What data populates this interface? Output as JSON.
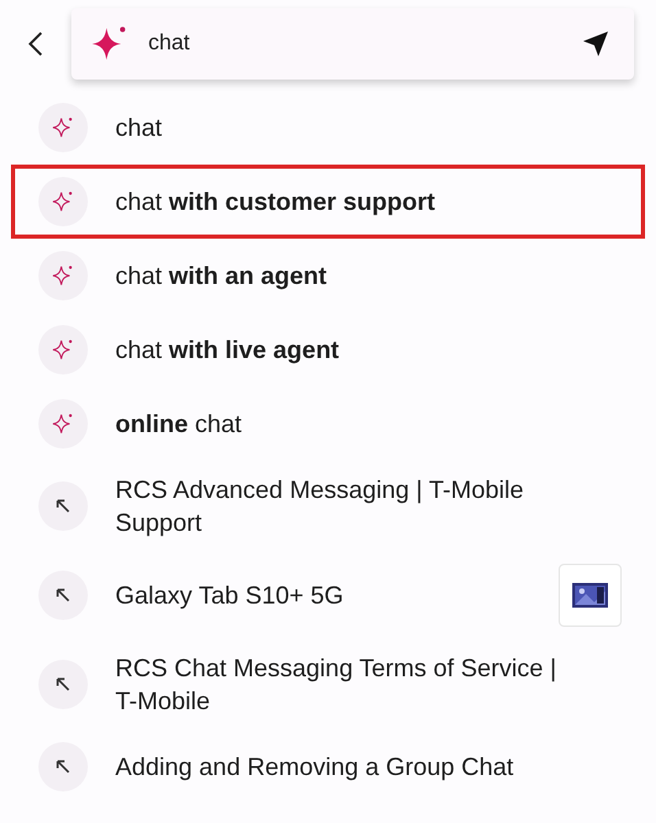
{
  "search": {
    "value": "chat"
  },
  "suggestions": [
    {
      "kind": "query",
      "text": "chat",
      "selected": false
    },
    {
      "kind": "query",
      "text": "chat **with customer support**",
      "selected": true
    },
    {
      "kind": "query",
      "text": "chat **with an agent**",
      "selected": false
    },
    {
      "kind": "query",
      "text": "chat **with live agent**",
      "selected": false
    },
    {
      "kind": "query",
      "text": "**online** chat",
      "selected": false
    },
    {
      "kind": "page",
      "text": "RCS Advanced Messaging | T-Mobile Support",
      "selected": false
    },
    {
      "kind": "page",
      "text": "Galaxy Tab S10+ 5G",
      "selected": false
    },
    {
      "kind": "page",
      "text": "RCS Chat Messaging Terms of Service | T-Mobile",
      "selected": false
    },
    {
      "kind": "page",
      "text": "Adding and Removing a Group Chat",
      "selected": false
    }
  ]
}
